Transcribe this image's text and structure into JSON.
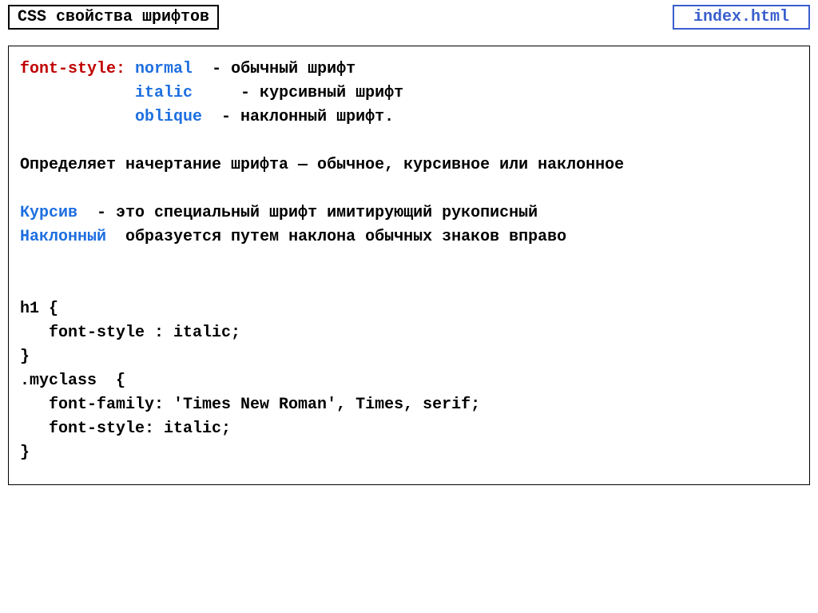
{
  "header": {
    "title": "CSS свойства шрифтов",
    "filename": "index.html"
  },
  "content": {
    "prop": "font-style:",
    "v1": "normal",
    "d1": "  - обычный шрифт",
    "pad": "            ",
    "v2": "italic",
    "d2": "     - курсивный шрифт",
    "v3": "oblique",
    "d3": "  - наклонный шрифт.",
    "summary": "Определяет начертание шрифта — обычное, курсивное или наклонное",
    "kursiv_label": "Курсив",
    "kursiv_text": "  - это специальный шрифт имитирующий рукописный",
    "naklon_label": "Наклонный",
    "naklon_text": "  образуется путем наклона обычных знаков вправо",
    "code_l1": "h1 {",
    "code_l2": "   font-style : italic;",
    "code_l3": "}",
    "code_l4": ".myclass  {",
    "code_l5": "   font-family: 'Times New Roman', Times, serif;",
    "code_l6": "   font-style: italic;",
    "code_l7": "}"
  }
}
